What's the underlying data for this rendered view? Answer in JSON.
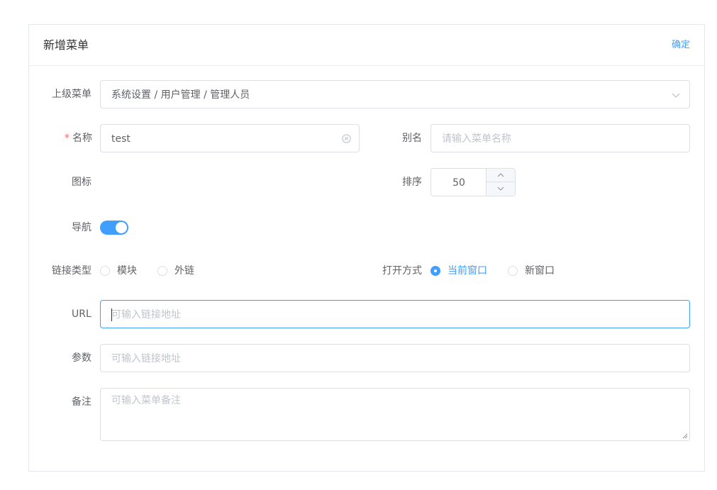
{
  "header": {
    "title": "新增菜单",
    "confirm_label": "确定"
  },
  "form": {
    "parent": {
      "label": "上级菜单",
      "value": "系统设置 / 用户管理 / 管理人员"
    },
    "name": {
      "required_mark": "*",
      "label": "名称",
      "value": "test"
    },
    "alias": {
      "label": "别名",
      "placeholder": "请输入菜单名称"
    },
    "icon": {
      "label": "图标"
    },
    "sort": {
      "label": "排序",
      "value": "50"
    },
    "nav": {
      "label": "导航",
      "enabled": true
    },
    "link_type": {
      "label": "链接类型",
      "options": [
        "模块",
        "外链"
      ],
      "selected": null
    },
    "open_mode": {
      "label": "打开方式",
      "options": [
        "当前窗口",
        "新窗口"
      ],
      "selected": "当前窗口"
    },
    "url": {
      "label": "URL",
      "placeholder": "可输入链接地址"
    },
    "params": {
      "label": "参数",
      "placeholder": "可输入链接地址"
    },
    "remark": {
      "label": "备注",
      "placeholder": "可输入菜单备注"
    }
  },
  "colors": {
    "primary": "#409eff",
    "required": "#f56c6c",
    "border": "#dcdfe6",
    "placeholder": "#c0c4cc"
  }
}
